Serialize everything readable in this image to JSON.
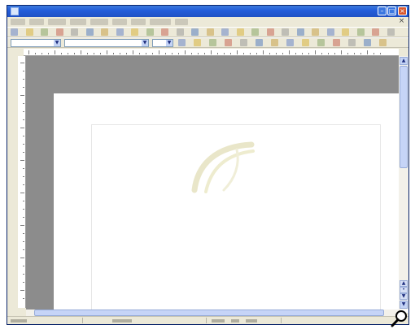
{
  "window": {
    "title": "",
    "controls": {
      "minimize": "–",
      "maximize": "□",
      "close": "×"
    }
  },
  "menubar": {
    "items": [
      {
        "label": ""
      },
      {
        "label": ""
      },
      {
        "label": ""
      },
      {
        "label": ""
      },
      {
        "label": ""
      },
      {
        "label": ""
      },
      {
        "label": ""
      },
      {
        "label": ""
      },
      {
        "label": ""
      }
    ],
    "document_close": "×"
  },
  "toolbars": {
    "standard": {
      "icons": [
        "new-document-icon",
        "open-icon",
        "save-icon",
        "email-icon",
        "edit-file-icon",
        "export-pdf-icon",
        "print-icon",
        "print-preview-icon",
        "spellcheck-icon",
        "autospellcheck-icon",
        "cut-icon",
        "copy-icon",
        "paste-icon",
        "format-paintbrush-icon",
        "undo-icon",
        "redo-icon",
        "hyperlink-icon",
        "table-icon",
        "draw-functions-icon",
        "find-replace-icon",
        "navigator-icon",
        "gallery-icon",
        "data-sources-icon",
        "nonprinting-characters-icon",
        "zoom-icon",
        "help-icon"
      ]
    },
    "formatting": {
      "style_value": "",
      "font_value": "",
      "size_value": "",
      "icons": [
        "bold-icon",
        "italic-icon",
        "underline-icon",
        "align-left-icon",
        "align-center-icon",
        "align-right-icon",
        "justify-icon",
        "numbering-icon",
        "bullets-icon",
        "decrease-indent-icon",
        "increase-indent-icon",
        "font-color-icon",
        "highlight-icon",
        "background-color-icon"
      ]
    }
  },
  "statusbar": {
    "page": "",
    "style": "",
    "zoom": ""
  },
  "colors": {
    "titlebar": "#245edb",
    "workspace": "#8c8c8c",
    "page": "#ffffff",
    "chrome": "#ece9d8"
  }
}
